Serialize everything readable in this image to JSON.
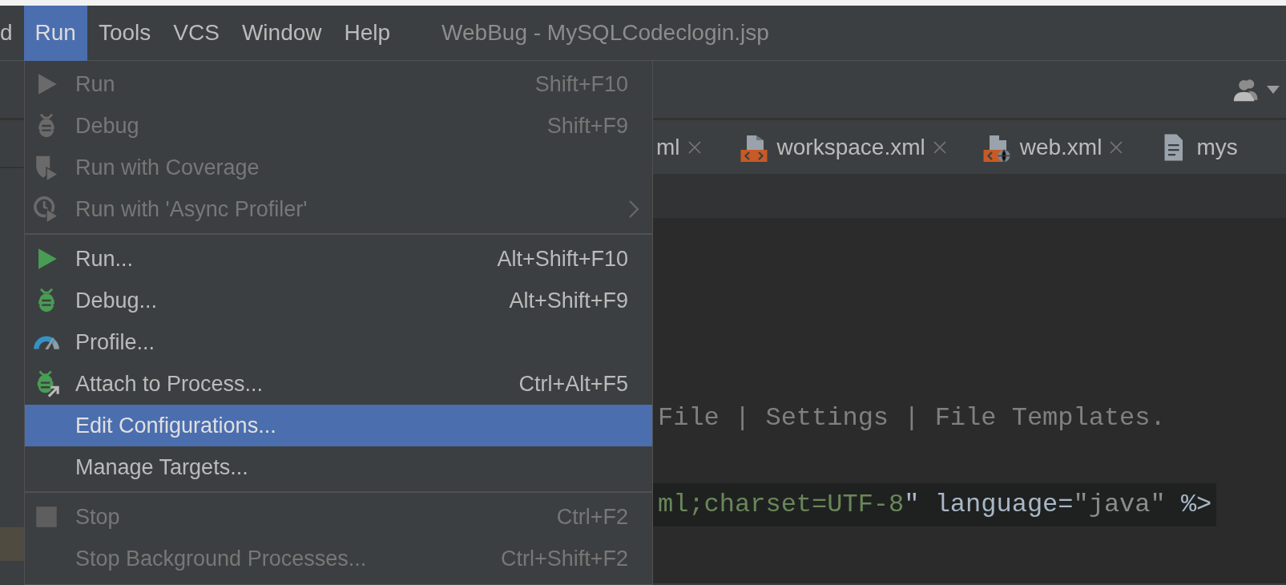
{
  "menu_bar": {
    "items": [
      {
        "label": "d",
        "selected": false
      },
      {
        "label": "Run",
        "selected": true
      },
      {
        "label": "Tools",
        "selected": false
      },
      {
        "label": "VCS",
        "selected": false
      },
      {
        "label": "Window",
        "selected": false
      },
      {
        "label": "Help",
        "selected": false
      }
    ],
    "window_title": "WebBug - MySQLCodeclogin.jsp"
  },
  "editor_tabs": [
    {
      "label": "ml",
      "kind": "plain"
    },
    {
      "label": "workspace.xml",
      "kind": "xml"
    },
    {
      "label": "web.xml",
      "kind": "webxml"
    },
    {
      "label": "mys",
      "kind": "text"
    }
  ],
  "code_lines": [
    {
      "highlighted": false,
      "segments": [
        {
          "text": "File | Settings | File Templates.",
          "kind": "comment"
        }
      ]
    },
    {
      "highlighted": true,
      "segments": [
        {
          "text": "ml;charset=UTF-8",
          "kind": "string"
        },
        {
          "text": "\" language=",
          "kind": "plain"
        },
        {
          "text": "\"java\"",
          "kind": "value"
        },
        {
          "text": " %>",
          "kind": "plain"
        }
      ]
    }
  ],
  "run_menu": [
    {
      "kind": "run",
      "label": "Run",
      "shortcut": "Shift+F10",
      "disabled": true,
      "selected": false,
      "submenu": false
    },
    {
      "kind": "debug",
      "label": "Debug",
      "shortcut": "Shift+F9",
      "disabled": true,
      "selected": false,
      "submenu": false
    },
    {
      "kind": "coverage",
      "label": "Run with Coverage",
      "disabled": true,
      "selected": false,
      "submenu": false
    },
    {
      "kind": "profiler",
      "label": "Run with 'Async Profiler'",
      "disabled": true,
      "selected": false,
      "submenu": true
    },
    {
      "kind": "separator"
    },
    {
      "kind": "run",
      "label": "Run...",
      "shortcut": "Alt+Shift+F10",
      "disabled": false,
      "selected": false,
      "submenu": false
    },
    {
      "kind": "debug",
      "label": "Debug...",
      "shortcut": "Alt+Shift+F9",
      "disabled": false,
      "selected": false,
      "submenu": false
    },
    {
      "kind": "profile",
      "label": "Profile...",
      "disabled": false,
      "selected": false,
      "submenu": false
    },
    {
      "kind": "attach",
      "label": "Attach to Process...",
      "shortcut": "Ctrl+Alt+F5",
      "disabled": false,
      "selected": false,
      "submenu": false
    },
    {
      "kind": "plain",
      "label": "Edit Configurations...",
      "disabled": false,
      "selected": true,
      "submenu": false
    },
    {
      "kind": "plain",
      "label": "Manage Targets...",
      "disabled": false,
      "selected": false,
      "submenu": false
    },
    {
      "kind": "separator"
    },
    {
      "kind": "stop",
      "label": "Stop",
      "shortcut": "Ctrl+F2",
      "disabled": true,
      "selected": false,
      "submenu": false
    },
    {
      "kind": "plain",
      "label": "Stop Background Processes...",
      "shortcut": "Ctrl+Shift+F2",
      "disabled": true,
      "selected": false,
      "submenu": false
    }
  ]
}
